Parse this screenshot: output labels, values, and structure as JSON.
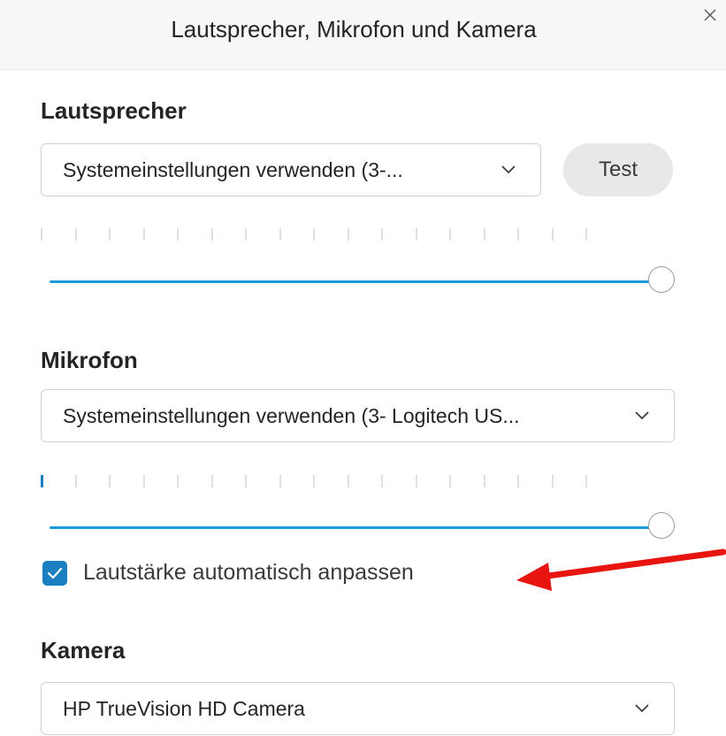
{
  "dialog": {
    "title": "Lautsprecher, Mikrofon und Kamera",
    "close_icon": "close-icon"
  },
  "speaker": {
    "label": "Lautsprecher",
    "selected": "Systemeinstellungen verwenden (3-...",
    "test_label": "Test",
    "level_ticks": 17,
    "level_active": 0,
    "volume": 1.0
  },
  "microphone": {
    "label": "Mikrofon",
    "selected": "Systemeinstellungen verwenden (3- Logitech US...",
    "level_ticks": 17,
    "level_active": 1,
    "volume": 1.0,
    "auto_adjust": {
      "label": "Lautstärke automatisch anpassen",
      "checked": true
    }
  },
  "camera": {
    "label": "Kamera",
    "selected": "HP TrueVision HD Camera"
  },
  "colors": {
    "accent": "#1a7fc1",
    "slider_fill": "#1a9ad8",
    "annotation_arrow": "#e8140f"
  }
}
